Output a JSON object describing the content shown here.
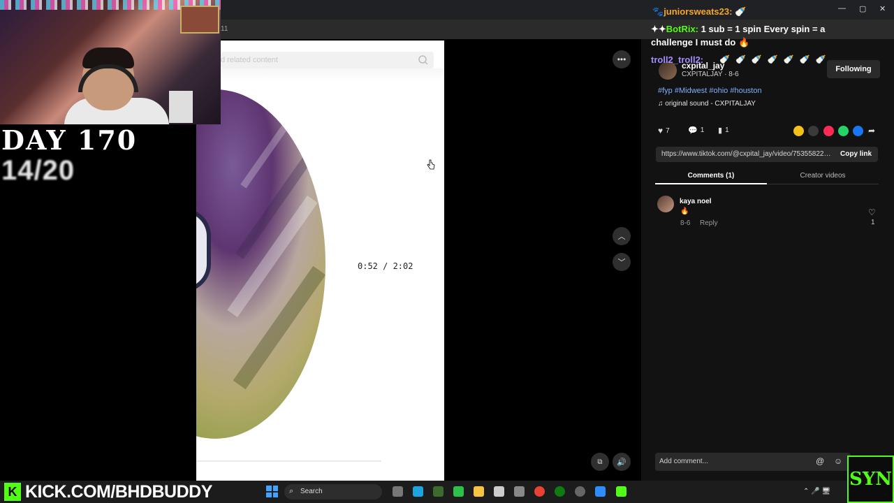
{
  "browser": {
    "address_fragment": "11",
    "window_controls": [
      "—",
      "▢",
      "✕"
    ]
  },
  "overlay": {
    "day_label": "DAY 170",
    "counter": "14/20",
    "kick_url": "KICK.COM/BHDBUDDY",
    "kick_logo_letter": "K",
    "syn_logo": "SYN"
  },
  "chat": {
    "user1": "juniorsweats23:",
    "line2_bot": "BotRix:",
    "line2_text": "1 sub = 1 spin    Every spin = a",
    "line3_text": "challenge I must do 🔥",
    "user3": "troll2_troll2:",
    "emotes": "🍼🍼🍼🍼🍼🍼🍼"
  },
  "tiktok": {
    "search_placeholder": "d related content",
    "timecode": "0:52 / 2:02",
    "author_name": "cxpital_jay",
    "author_sub": "CXPITALJAY · 8-6",
    "follow_label": "Following",
    "hashtags": "#fyp #Midwest #ohio #houston",
    "music": "original sound - CXPITALJAY",
    "likes": "7",
    "comments_count": "1",
    "saves": "1",
    "link": "https://www.tiktok.com/@cxpital_jay/video/753558225...",
    "copy_link": "Copy link",
    "tab_comments": "Comments (1)",
    "tab_creator": "Creator videos",
    "comment": {
      "name": "kaya noel",
      "text": "🔥",
      "date": "8-6",
      "reply": "Reply",
      "likes": "1"
    },
    "add_comment_placeholder": "Add comment..."
  },
  "taskbar": {
    "search_label": "Search"
  },
  "colors": {
    "kick_green": "#53fc18",
    "hashtag_blue": "#7eb0ff",
    "chat_orange": "#f5a623",
    "chat_purple": "#a58cff"
  }
}
